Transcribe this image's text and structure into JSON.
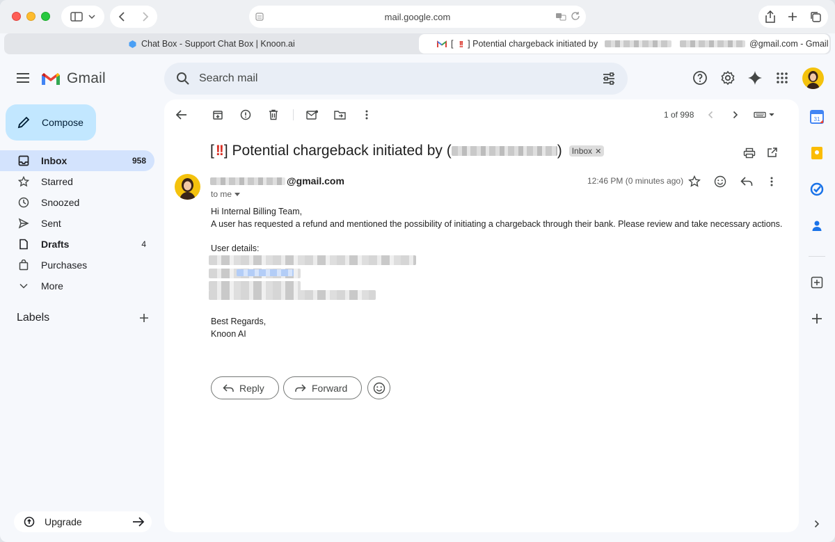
{
  "browser": {
    "url": "mail.google.com",
    "tabs": [
      {
        "label": "Chat Box - Support Chat Box | Knoon.ai"
      },
      {
        "label_prefix": "[",
        "label_mark": "!!",
        "label_mid": "] Potential chargeback initiated by",
        "label_suffix": "@gmail.com - Gmail"
      }
    ]
  },
  "gmail": {
    "brand": "Gmail",
    "search_placeholder": "Search mail",
    "compose_label": "Compose",
    "nav": [
      {
        "label": "Inbox",
        "count": "958",
        "icon": "inbox-icon"
      },
      {
        "label": "Starred",
        "count": "",
        "icon": "star-icon"
      },
      {
        "label": "Snoozed",
        "count": "",
        "icon": "clock-icon"
      },
      {
        "label": "Sent",
        "count": "",
        "icon": "send-icon"
      },
      {
        "label": "Drafts",
        "count": "4",
        "icon": "draft-icon"
      },
      {
        "label": "Purchases",
        "count": "",
        "icon": "purchases-icon"
      },
      {
        "label": "More",
        "count": "",
        "icon": "chevron-down-icon"
      }
    ],
    "labels_title": "Labels",
    "upgrade_label": "Upgrade",
    "accent_color": "#d3e3fd",
    "compose_color": "#c2e7ff"
  },
  "message": {
    "pager": "1 of 998",
    "subject_open": "[",
    "subject_mark": "!!",
    "subject_text": "] Potential chargeback initiated by (",
    "subject_close": ")",
    "label_chip": "Inbox",
    "sender_suffix": "@gmail.com",
    "to": "to me",
    "time": "12:46 PM (0 minutes ago)",
    "greeting": "Hi Internal Billing Team,",
    "body": "A user has requested a refund and mentioned the possibility of initiating a chargeback through their bank. Please review and take necessary actions.",
    "details_heading": "User details:",
    "signoff": "Best Regards,",
    "signature": "Knoon AI",
    "reply_label": "Reply",
    "forward_label": "Forward"
  }
}
